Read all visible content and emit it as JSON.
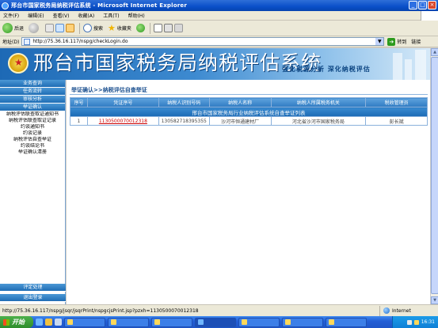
{
  "window": {
    "title": "邢台市国家税务局纳税评估系统 - Microsoft Internet Explorer",
    "controls": [
      "_",
      "□",
      "×"
    ]
  },
  "menu": [
    "文件(F)",
    "编辑(E)",
    "查看(V)",
    "收藏(A)",
    "工具(T)",
    "帮助(H)"
  ],
  "toolbar": {
    "back": "后退",
    "search": "搜索",
    "favorites": "收藏夹"
  },
  "address": {
    "label": "地址(D)",
    "url": "http://75.36.16.117/nspg/checkLogin.do",
    "go": "转到",
    "links": "链接"
  },
  "banner": {
    "title": "邢台市国家税务局纳税评估系统",
    "slogan": "强化税源分析  深化纳税评估"
  },
  "nav": {
    "sections": [
      {
        "label": "业务查询"
      },
      {
        "label": "任务流转"
      },
      {
        "label": "审核分析"
      },
      {
        "label": "举证确认"
      }
    ],
    "subitems": [
      {
        "label": "纳税评估联查取证通知书"
      },
      {
        "label": "纳税评估联查取证记录"
      },
      {
        "label": "约谈通知书"
      },
      {
        "label": "约谈记录"
      },
      {
        "label": "纳税评估自查举证"
      },
      {
        "label": "约谈结论书"
      },
      {
        "label": "举证确认清册"
      }
    ],
    "bottom": [
      {
        "label": "评定处理"
      },
      {
        "label": "退出登录"
      }
    ]
  },
  "main": {
    "breadcrumb": "举证确认>>纳税评估自查举证",
    "table_title": "邢台市国家税务局行业纳税评估系统自查举证列表",
    "columns": [
      "序号",
      "凭证序号",
      "纳税人识别号码",
      "纳税人名称",
      "纳税人所属税务机关",
      "税收管理员"
    ],
    "rows": [
      {
        "no": "1",
        "voucher": "1130500070012318",
        "taxpayer_id": "130582718395355",
        "taxpayer_name": "沙河市恒通建材厂",
        "tax_office": "河北省沙河市国家税务局",
        "manager": "彭长斌"
      }
    ]
  },
  "status": {
    "url": "http://75.36.16.117/nspg/jsqr/jsqrPrint/nspgcjsPrint.jsp?pzxh=1130500070012318",
    "zone": "Internet"
  },
  "taskbar": {
    "start": "开始",
    "tasks": [
      "",
      "",
      "",
      "",
      "",
      "",
      ""
    ],
    "clock": "16:31"
  }
}
